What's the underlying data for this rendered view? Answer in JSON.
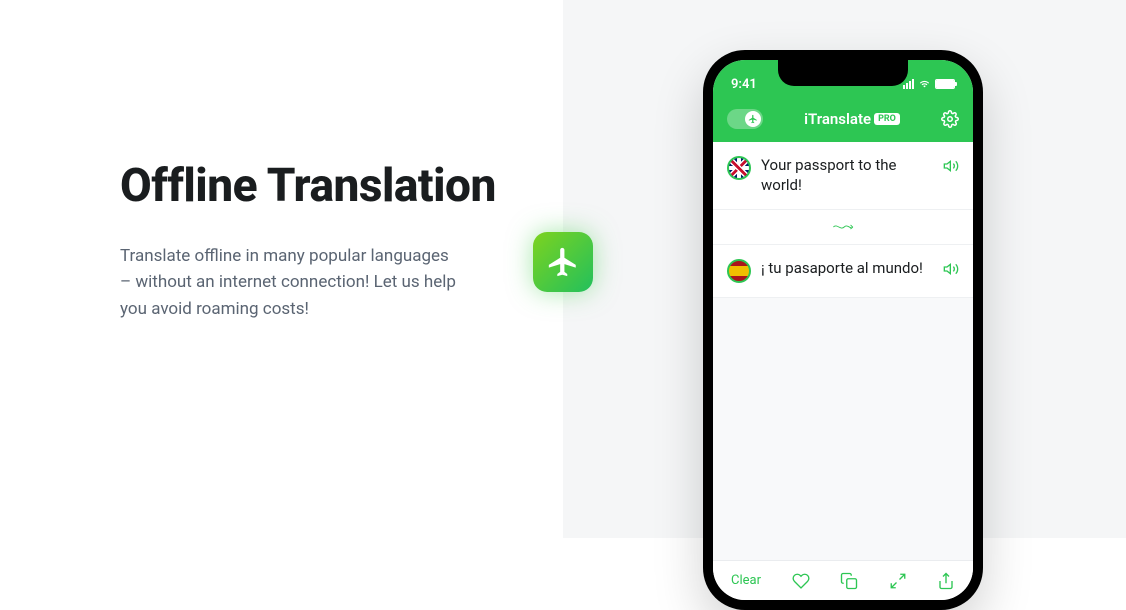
{
  "marketing": {
    "heading": "Offline Translation",
    "description": "Translate offline in many popular languages – without an internet connection! Let us help you avoid roaming costs!"
  },
  "phone": {
    "status": {
      "time": "9:41"
    },
    "header": {
      "app_name": "iTranslate",
      "pro_label": "PRO"
    },
    "source": {
      "text": "Your passport to the world!"
    },
    "target": {
      "text": "¡ tu pasaporte al mundo!"
    },
    "bottom": {
      "clear_label": "Clear"
    }
  }
}
